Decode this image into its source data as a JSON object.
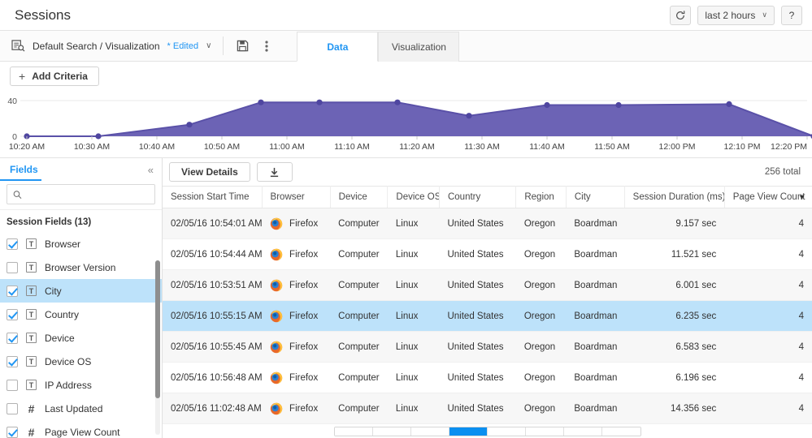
{
  "header": {
    "title": "Sessions",
    "refresh_icon": "refresh-icon",
    "time_range": "last 2 hours",
    "time_range_caret": "∨",
    "help_label": "?"
  },
  "searchbar": {
    "search_icon": "saved-search-icon",
    "name": "Default Search / Visualization",
    "edited_badge": "* Edited",
    "caret": "∨",
    "save_icon": "save-icon",
    "more_icon": "more-vertical-icon",
    "tabs": [
      {
        "label": "Data",
        "active": true
      },
      {
        "label": "Visualization",
        "active": false
      }
    ]
  },
  "criteria": {
    "plus": "+",
    "add_label": "Add Criteria"
  },
  "chart_data": {
    "type": "area",
    "title": "",
    "xlabel": "",
    "ylabel": "",
    "ylim": [
      0,
      40
    ],
    "yticks": [
      0,
      40
    ],
    "ytick_labels": [
      "0",
      "40"
    ],
    "grid": true,
    "legend": "none",
    "line_color": "#5a51a8",
    "fill_color": "#6c63b5",
    "point_color": "#4f46a0",
    "categories": [
      "10:20 AM",
      "10:30 AM",
      "10:40 AM",
      "10:50 AM",
      "11:00 AM",
      "11:10 AM",
      "11:20 AM",
      "11:30 AM",
      "11:40 AM",
      "11:50 AM",
      "12:00 PM",
      "12:10 PM",
      "12:20 PM"
    ],
    "x": [
      "10:20 AM",
      "10:31 AM",
      "10:45 AM",
      "10:56 AM",
      "11:05 AM",
      "11:17 AM",
      "11:28 AM",
      "11:40 AM",
      "11:51 AM",
      "12:08 PM",
      "12:21 PM"
    ],
    "values": [
      0,
      0,
      13,
      38,
      38,
      38,
      23,
      35,
      35,
      36,
      0
    ]
  },
  "sidebar": {
    "title": "Fields",
    "collapse_icon": "collapse-left-icon",
    "search_placeholder": "",
    "search_value": "",
    "search_icon": "search-icon",
    "group_label": "Session Fields (13)",
    "items": [
      {
        "label": "Browser",
        "type": "T",
        "checked": true,
        "selected": false
      },
      {
        "label": "Browser Version",
        "type": "T",
        "checked": false,
        "selected": false
      },
      {
        "label": "City",
        "type": "T",
        "checked": true,
        "selected": true
      },
      {
        "label": "Country",
        "type": "T",
        "checked": true,
        "selected": false
      },
      {
        "label": "Device",
        "type": "T",
        "checked": true,
        "selected": false
      },
      {
        "label": "Device OS",
        "type": "T",
        "checked": true,
        "selected": false
      },
      {
        "label": "IP Address",
        "type": "T",
        "checked": false,
        "selected": false
      },
      {
        "label": "Last Updated",
        "type": "#",
        "checked": false,
        "selected": false
      },
      {
        "label": "Page View Count",
        "type": "#",
        "checked": true,
        "selected": false
      }
    ]
  },
  "table": {
    "view_details_label": "View Details",
    "download_icon": "download-icon",
    "total_label": "256 total",
    "sort_caret": "⌄",
    "columns": [
      {
        "label": "Session Start Time",
        "align": "left"
      },
      {
        "label": "Browser",
        "align": "left"
      },
      {
        "label": "Device",
        "align": "left"
      },
      {
        "label": "Device OS",
        "align": "left"
      },
      {
        "label": "Country",
        "align": "left"
      },
      {
        "label": "Region",
        "align": "left"
      },
      {
        "label": "City",
        "align": "left"
      },
      {
        "label": "Session Duration (ms)",
        "align": "right"
      },
      {
        "label": "Page View Count",
        "align": "right",
        "sorted": true
      }
    ],
    "rows": [
      {
        "start": "02/05/16 10:54:01 AM",
        "browser": "Firefox",
        "device": "Computer",
        "os": "Linux",
        "country": "United States",
        "region": "Oregon",
        "city": "Boardman",
        "duration": "9.157 sec",
        "views": "4",
        "highlight": false
      },
      {
        "start": "02/05/16 10:54:44 AM",
        "browser": "Firefox",
        "device": "Computer",
        "os": "Linux",
        "country": "United States",
        "region": "Oregon",
        "city": "Boardman",
        "duration": "11.521 sec",
        "views": "4",
        "highlight": false
      },
      {
        "start": "02/05/16 10:53:51 AM",
        "browser": "Firefox",
        "device": "Computer",
        "os": "Linux",
        "country": "United States",
        "region": "Oregon",
        "city": "Boardman",
        "duration": "6.001 sec",
        "views": "4",
        "highlight": false
      },
      {
        "start": "02/05/16 10:55:15 AM",
        "browser": "Firefox",
        "device": "Computer",
        "os": "Linux",
        "country": "United States",
        "region": "Oregon",
        "city": "Boardman",
        "duration": "6.235 sec",
        "views": "4",
        "highlight": true
      },
      {
        "start": "02/05/16 10:55:45 AM",
        "browser": "Firefox",
        "device": "Computer",
        "os": "Linux",
        "country": "United States",
        "region": "Oregon",
        "city": "Boardman",
        "duration": "6.583 sec",
        "views": "4",
        "highlight": false
      },
      {
        "start": "02/05/16 10:56:48 AM",
        "browser": "Firefox",
        "device": "Computer",
        "os": "Linux",
        "country": "United States",
        "region": "Oregon",
        "city": "Boardman",
        "duration": "6.196 sec",
        "views": "4",
        "highlight": false
      },
      {
        "start": "02/05/16 11:02:48 AM",
        "browser": "Firefox",
        "device": "Computer",
        "os": "Linux",
        "country": "United States",
        "region": "Oregon",
        "city": "Boardman",
        "duration": "14.356 sec",
        "views": "4",
        "highlight": false
      }
    ]
  },
  "pagination": {
    "cells": 8,
    "active_index": 3
  }
}
